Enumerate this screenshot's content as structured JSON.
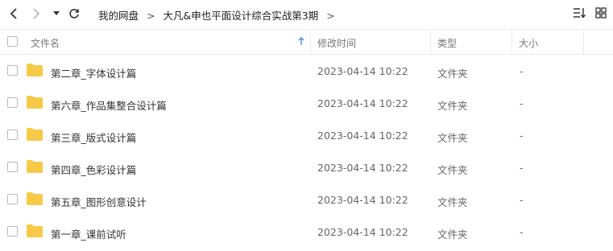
{
  "breadcrumb": {
    "root": "我的网盘",
    "current": "大凡&申也平面设计综合实战第3期"
  },
  "columns": {
    "name": "文件名",
    "modified": "修改时间",
    "type": "类型",
    "size": "大小"
  },
  "files": [
    {
      "name": "第二章_字体设计篇",
      "modified": "2023-04-14 10:22",
      "type": "文件夹",
      "size": "-"
    },
    {
      "name": "第六章_作品集整合设计篇",
      "modified": "2023-04-14 10:22",
      "type": "文件夹",
      "size": "-"
    },
    {
      "name": "第三章_版式设计篇",
      "modified": "2023-04-14 10:22",
      "type": "文件夹",
      "size": "-"
    },
    {
      "name": "第四章_色彩设计篇",
      "modified": "2023-04-14 10:22",
      "type": "文件夹",
      "size": "-"
    },
    {
      "name": "第五章_图形创意设计",
      "modified": "2023-04-14 10:22",
      "type": "文件夹",
      "size": "-"
    },
    {
      "name": "第一章_课前试听",
      "modified": "2023-04-14 10:22",
      "type": "文件夹",
      "size": "-"
    }
  ],
  "icons": {
    "folder_color": "#f7c948",
    "sort_arrow_color": "#3a8ee6"
  }
}
